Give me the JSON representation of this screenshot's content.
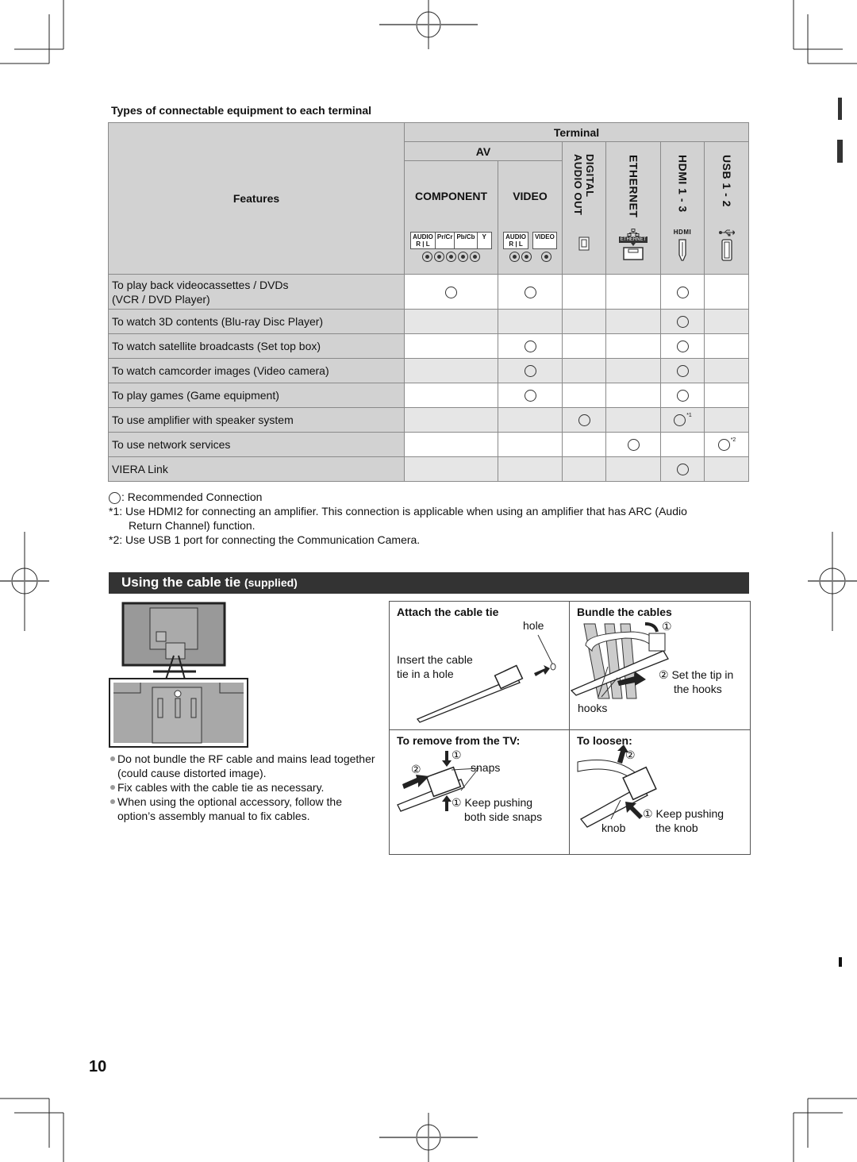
{
  "section_caption": "Types of connectable equipment to each terminal",
  "table": {
    "features_header": "Features",
    "terminal_header": "Terminal",
    "av_header": "AV",
    "columns": [
      {
        "key": "component",
        "label": "COMPONENT",
        "port_labels": [
          "AUDIO R | L",
          "Pr/Cr",
          "Pb/Cb",
          "Y"
        ],
        "icon": "rca-jacks-5-icon"
      },
      {
        "key": "video",
        "label": "VIDEO",
        "port_labels": [
          "AUDIO R | L",
          "VIDEO"
        ],
        "icon": "rca-jacks-3-icon"
      },
      {
        "key": "digital_audio_out",
        "label": "DIGITAL AUDIO OUT",
        "icon": "optical-port-icon"
      },
      {
        "key": "ethernet",
        "label": "ETHERNET",
        "port_badge": "ETHERNET",
        "icon": "ethernet-port-icon"
      },
      {
        "key": "hdmi",
        "label": "HDMI 1 - 3",
        "port_badge": "HDMI",
        "icon": "hdmi-port-icon"
      },
      {
        "key": "usb",
        "label": "USB 1 - 2",
        "icon": "usb-port-icon"
      }
    ],
    "rows": [
      {
        "feature": "To play back videocassettes / DVDs (VCR / DVD Player)",
        "feature_line1": "To play back videocassettes / DVDs",
        "feature_line2": "(VCR / DVD Player)",
        "marks": [
          true,
          true,
          false,
          false,
          true,
          false
        ],
        "notes": [
          "",
          "",
          "",
          "",
          "",
          ""
        ]
      },
      {
        "feature": "To watch 3D contents (Blu-ray Disc Player)",
        "marks": [
          false,
          false,
          false,
          false,
          true,
          false
        ],
        "notes": [
          "",
          "",
          "",
          "",
          "",
          ""
        ]
      },
      {
        "feature": "To watch satellite broadcasts (Set top box)",
        "marks": [
          false,
          true,
          false,
          false,
          true,
          false
        ],
        "notes": [
          "",
          "",
          "",
          "",
          "",
          ""
        ]
      },
      {
        "feature": "To watch camcorder images (Video camera)",
        "marks": [
          false,
          true,
          false,
          false,
          true,
          false
        ],
        "notes": [
          "",
          "",
          "",
          "",
          "",
          ""
        ]
      },
      {
        "feature": "To play games (Game equipment)",
        "marks": [
          false,
          true,
          false,
          false,
          true,
          false
        ],
        "notes": [
          "",
          "",
          "",
          "",
          "",
          ""
        ]
      },
      {
        "feature": "To use amplifier with speaker system",
        "marks": [
          false,
          false,
          true,
          false,
          true,
          false
        ],
        "notes": [
          "",
          "",
          "",
          "",
          "*1",
          ""
        ]
      },
      {
        "feature": "To use network services",
        "marks": [
          false,
          false,
          false,
          true,
          false,
          true
        ],
        "notes": [
          "",
          "",
          "",
          "",
          "",
          "*2"
        ]
      },
      {
        "feature": "VIERA Link",
        "marks": [
          false,
          false,
          false,
          false,
          true,
          false
        ],
        "notes": [
          "",
          "",
          "",
          "",
          "",
          ""
        ]
      }
    ]
  },
  "legend": {
    "recommended": ": Recommended Connection",
    "note1_key": "*1:",
    "note1_line1": "Use HDMI2 for connecting an amplifier. This connection is applicable when using an amplifier that has ARC (Audio",
    "note1_line2": "Return Channel) function.",
    "note2_key": "*2:",
    "note2": "Use USB 1 port for connecting the Communication Camera."
  },
  "cable_tie": {
    "title": "Using the cable tie",
    "title_suffix": "(supplied)",
    "bullets": [
      "Do not bundle the RF cable and mains lead together (could cause distorted image).",
      "Fix cables with the cable tie as necessary.",
      "When using the optional accessory, follow the option’s assembly manual to fix cables."
    ],
    "steps": {
      "attach": {
        "title": "Attach the cable tie",
        "hole": "hole",
        "instruction_line1": "Insert the cable",
        "instruction_line2": "tie in a hole"
      },
      "bundle": {
        "title": "Bundle the cables",
        "step1": "①",
        "step2": "② Set the tip in",
        "step2_line2": "the hooks",
        "hooks": "hooks"
      },
      "remove": {
        "title": "To remove from the TV:",
        "step1a": "①",
        "step2": "②",
        "snaps": "snaps",
        "step1b": "① Keep pushing",
        "step1b_line2": "both side snaps"
      },
      "loosen": {
        "title": "To loosen:",
        "step2": "②",
        "step1": "① Keep pushing",
        "step1_line2": "the knob",
        "knob": "knob"
      }
    }
  },
  "page_number": "10"
}
